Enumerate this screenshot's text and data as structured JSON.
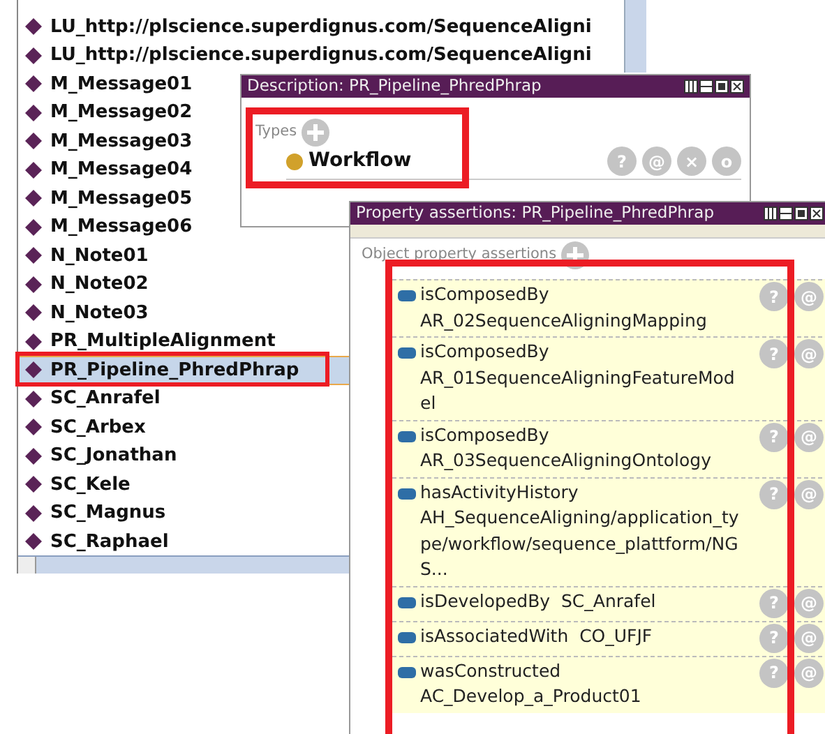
{
  "individuals": [
    {
      "label": "LU_http://plscience.superdignus.com/SequenceAligni",
      "selected": false
    },
    {
      "label": "LU_http://plscience.superdignus.com/SequenceAligni",
      "selected": false
    },
    {
      "label": "M_Message01",
      "selected": false
    },
    {
      "label": "M_Message02",
      "selected": false
    },
    {
      "label": "M_Message03",
      "selected": false
    },
    {
      "label": "M_Message04",
      "selected": false
    },
    {
      "label": "M_Message05",
      "selected": false
    },
    {
      "label": "M_Message06",
      "selected": false
    },
    {
      "label": "N_Note01",
      "selected": false
    },
    {
      "label": "N_Note02",
      "selected": false
    },
    {
      "label": "N_Note03",
      "selected": false
    },
    {
      "label": "PR_MultipleAlignment",
      "selected": false
    },
    {
      "label": "PR_Pipeline_PhredPhrap",
      "selected": true
    },
    {
      "label": "SC_Anrafel",
      "selected": false
    },
    {
      "label": "SC_Arbex",
      "selected": false
    },
    {
      "label": "SC_Jonathan",
      "selected": false
    },
    {
      "label": "SC_Kele",
      "selected": false
    },
    {
      "label": "SC_Magnus",
      "selected": false
    },
    {
      "label": "SC_Raphael",
      "selected": false
    }
  ],
  "description": {
    "title": "Description: PR_Pipeline_PhredPhrap",
    "section": "Types",
    "types": [
      {
        "label": "Workflow",
        "buttons": [
          "?",
          "@",
          "×",
          "o"
        ]
      }
    ]
  },
  "property_assertions": {
    "title": "Property assertions: PR_Pipeline_PhredPhrap",
    "section": "Object property assertions",
    "rows": [
      {
        "property": "isComposedBy",
        "value": "AR_02SequenceAligningMapping",
        "buttons": [
          "?",
          "@"
        ]
      },
      {
        "property": "isComposedBy",
        "value": "AR_01SequenceAligningFeatureModel",
        "buttons": [
          "?",
          "@"
        ]
      },
      {
        "property": "isComposedBy",
        "value": "AR_03SequenceAligningOntology",
        "buttons": [
          "?",
          "@"
        ]
      },
      {
        "property": "hasActivityHistory",
        "value": "AH_SequenceAligning/application_type/workflow/sequence_plattform/NGS...",
        "buttons": [
          "?",
          "@"
        ]
      },
      {
        "property": "isDevelopedBy",
        "value": "SC_Anrafel",
        "buttons": [
          "?",
          "@"
        ]
      },
      {
        "property": "isAssociatedWith",
        "value": "CO_UFJF",
        "buttons": [
          "?",
          "@"
        ]
      },
      {
        "property": "wasConstructed",
        "value": "AC_Develop_a_Product01",
        "buttons": [
          "?",
          "@"
        ]
      }
    ]
  }
}
